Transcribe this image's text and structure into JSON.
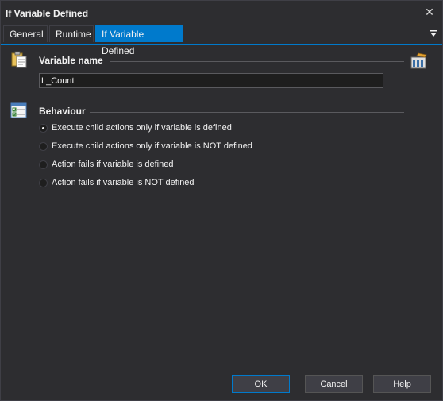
{
  "window": {
    "title": "If Variable Defined",
    "close_icon": "close-icon"
  },
  "tabs": [
    {
      "label": "General",
      "active": false
    },
    {
      "label": "Runtime",
      "active": false
    },
    {
      "label": "If Variable Defined",
      "active": true
    }
  ],
  "variable_section": {
    "label": "Variable name",
    "input_value": "L_Count",
    "icon": "clipboard-icon",
    "picker_icon": "variable-picker-icon"
  },
  "behaviour_section": {
    "label": "Behaviour",
    "icon": "options-list-icon",
    "options": [
      {
        "label": "Execute child actions only if variable is defined",
        "checked": true
      },
      {
        "label": "Execute child actions only if variable is NOT defined",
        "checked": false
      },
      {
        "label": "Action fails if variable is defined",
        "checked": false
      },
      {
        "label": "Action fails if variable is NOT defined",
        "checked": false
      }
    ]
  },
  "buttons": {
    "ok": "OK",
    "cancel": "Cancel",
    "help": "Help"
  },
  "colors": {
    "accent": "#007acc",
    "background": "#2d2d30",
    "input_bg": "#1e1e1e"
  }
}
